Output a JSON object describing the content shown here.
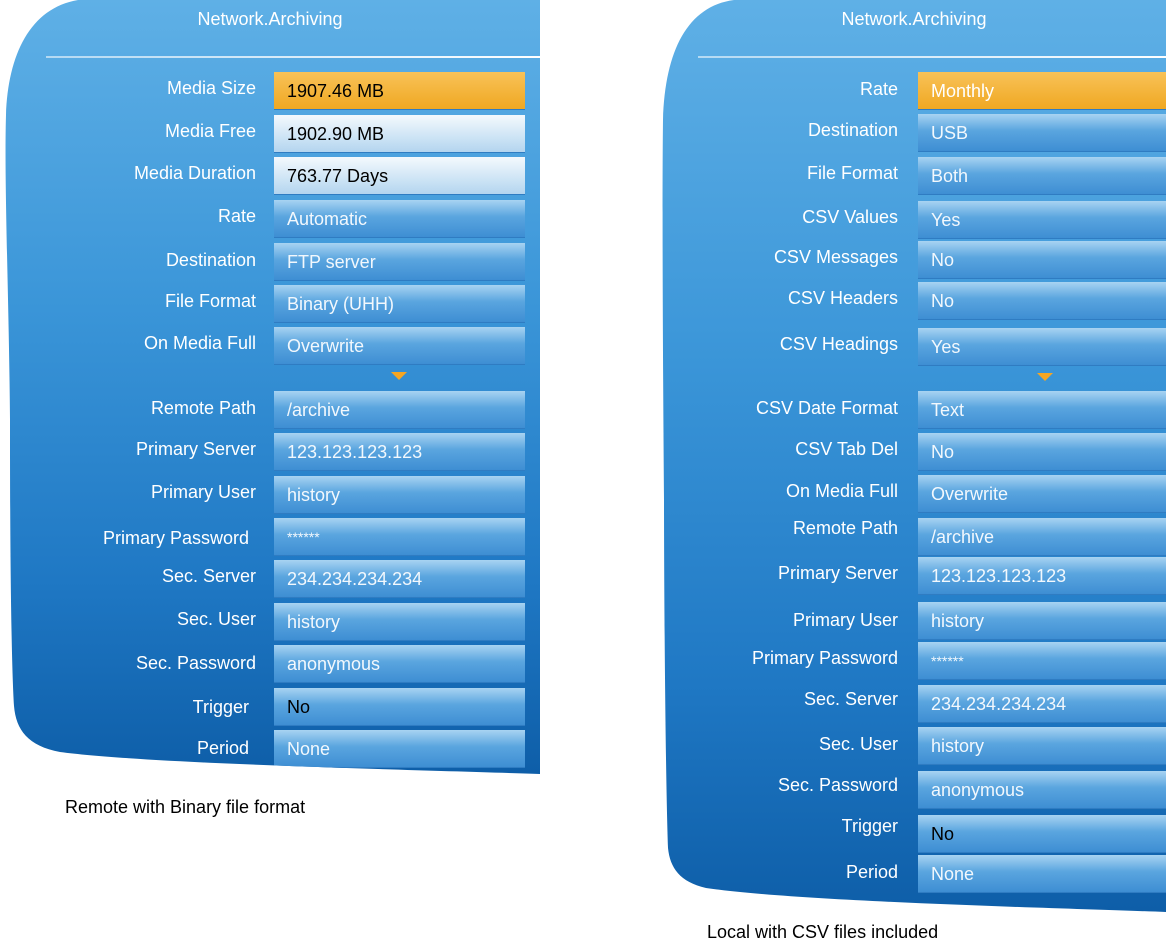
{
  "left_panel": {
    "title": "Network.Archiving",
    "rows": [
      {
        "label": "Media Size",
        "value": "1907.46 MB"
      },
      {
        "label": "Media Free",
        "value": "1902.90 MB"
      },
      {
        "label": "Media Duration",
        "value": "763.77 Days"
      },
      {
        "label": "Rate",
        "value": "Automatic"
      },
      {
        "label": "Destination",
        "value": "FTP server"
      },
      {
        "label": "File Format",
        "value": "Binary (UHH)"
      },
      {
        "label": "On Media Full",
        "value": "Overwrite"
      },
      {
        "label": "Remote Path",
        "value": "/archive"
      },
      {
        "label": "Primary Server",
        "value": "123.123.123.123"
      },
      {
        "label": "Primary User",
        "value": "history"
      },
      {
        "label": "Primary Password",
        "value": "******"
      },
      {
        "label": "Sec. Server",
        "value": "234.234.234.234"
      },
      {
        "label": "Sec. User",
        "value": "history"
      },
      {
        "label": "Sec. Password",
        "value": "anonymous"
      },
      {
        "label": "Trigger",
        "value": "No"
      },
      {
        "label": "Period",
        "value": "None"
      }
    ],
    "caption": "Remote with Binary file format"
  },
  "right_panel": {
    "title": "Network.Archiving",
    "rows": [
      {
        "label": "Rate",
        "value": "Monthly"
      },
      {
        "label": "Destination",
        "value": "USB"
      },
      {
        "label": "File Format",
        "value": "Both"
      },
      {
        "label": "CSV Values",
        "value": "Yes"
      },
      {
        "label": "CSV Messages",
        "value": "No"
      },
      {
        "label": "CSV Headers",
        "value": "No"
      },
      {
        "label": "CSV Headings",
        "value": "Yes"
      },
      {
        "label": "CSV Date Format",
        "value": "Text"
      },
      {
        "label": "CSV Tab Del",
        "value": "No"
      },
      {
        "label": "On Media Full",
        "value": "Overwrite"
      },
      {
        "label": "Remote Path",
        "value": "/archive"
      },
      {
        "label": "Primary Server",
        "value": "123.123.123.123"
      },
      {
        "label": "Primary User",
        "value": "history"
      },
      {
        "label": "Primary Password",
        "value": "******"
      },
      {
        "label": "Sec. Server",
        "value": "234.234.234.234"
      },
      {
        "label": "Sec. User",
        "value": "history"
      },
      {
        "label": "Sec. Password",
        "value": "anonymous"
      },
      {
        "label": "Trigger",
        "value": "No"
      },
      {
        "label": "Period",
        "value": "None"
      }
    ],
    "caption": "Local with CSV files included"
  },
  "icons": {
    "more_indicator": "chevron-down-icon"
  },
  "colors": {
    "selected": "#f0a822",
    "panel": "#3a95d8",
    "more_arrow": "#f5a623"
  }
}
